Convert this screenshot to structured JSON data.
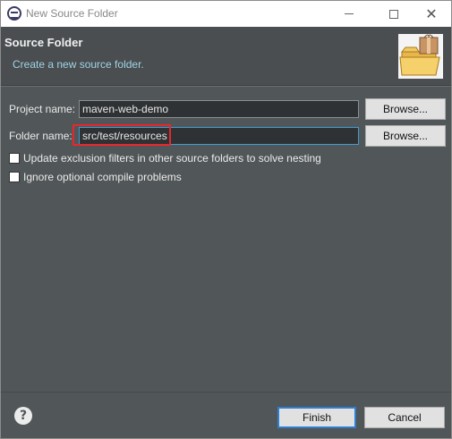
{
  "window": {
    "title": "New Source Folder",
    "icon": "eclipse-icon"
  },
  "header": {
    "title": "Source Folder",
    "description": "Create a new source folder.",
    "icon": "folder-package-icon"
  },
  "form": {
    "project_label": "Project name:",
    "project_value": "maven-web-demo",
    "folder_label": "Folder name:",
    "folder_value": "src/test/resources",
    "browse_label": "Browse..."
  },
  "options": [
    {
      "label": "Update exclusion filters in other source folders to solve nesting",
      "checked": false
    },
    {
      "label": "Ignore optional compile problems",
      "checked": false
    }
  ],
  "footer": {
    "finish_label": "Finish",
    "cancel_label": "Cancel",
    "help_glyph": "?"
  },
  "colors": {
    "dialog_bg": "#515658",
    "header_bg": "#4a4e50",
    "description_text": "#9fd3e4",
    "highlight": "#e8262c",
    "focus_border": "#3e9ed6"
  }
}
